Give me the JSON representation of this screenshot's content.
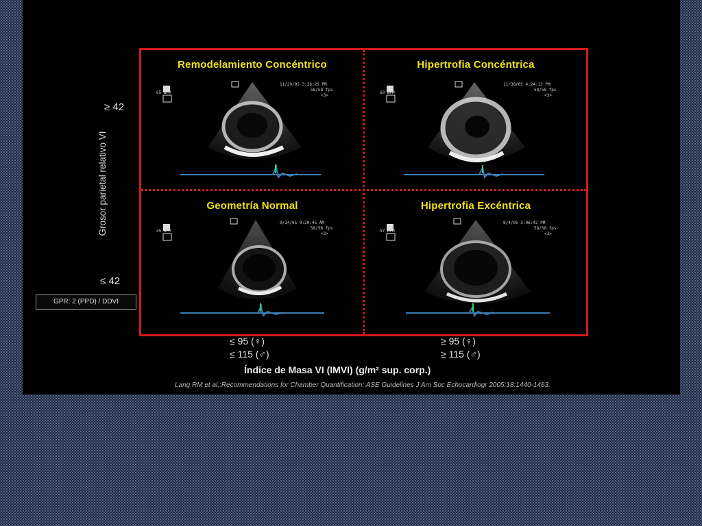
{
  "quadrants": {
    "top_left": {
      "title": "Remodelamiento Concéntrico",
      "bpm": "65 BPM",
      "timestamp": "11/29/05 3:26:25 PM",
      "fps": "58/58 fps",
      "zoom": "<3>"
    },
    "top_right": {
      "title": "Hipertrofia Concéntrica",
      "bpm": "60 BPM",
      "timestamp": "11/30/05 4:24:13 PM",
      "fps": "58/58 fps",
      "zoom": "<3>"
    },
    "bottom_left": {
      "title": "Geometría Normal",
      "bpm": "45 BPM",
      "timestamp": "9/14/05 9:20:45 AM",
      "fps": "58/58 fps",
      "zoom": "<3>"
    },
    "bottom_right": {
      "title": "Hipertrofia Excéntrica",
      "bpm": "57 BPM",
      "timestamp": "8/4/05 3:06:42 PM",
      "fps": "58/58 fps",
      "zoom": "<3>"
    }
  },
  "y_axis": {
    "label": "Grosor parietal relativo VI",
    "upper_tick": "≥ 42",
    "lower_tick": "≤ 42"
  },
  "formula": "GPR: 2 (PPD) / DDVI",
  "x_axis": {
    "left_line1": "≤ 95 (♀)",
    "left_line2": "≤ 115 (♂)",
    "right_line1": "≥ 95 (♀)",
    "right_line2": "≥ 115 (♂)",
    "label": "Índice de Masa VI (IMVI) (g/m² sup. corp.)"
  },
  "citation": "Lang RM et al.:Recommendations for Chamber Quantification: ASE Guidelines J Am Soc Echocardiogr 2005;18:1440-1463.",
  "colors": {
    "frame": "#d11a1a",
    "title": "#f2e21c",
    "ecg": "#3a7fb5"
  }
}
